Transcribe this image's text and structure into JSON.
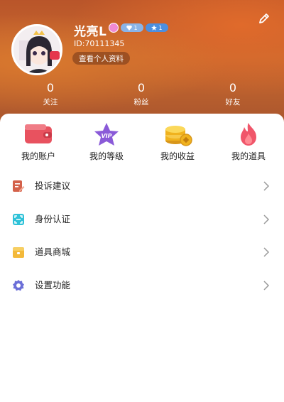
{
  "header": {
    "username": "光亮L",
    "badges": {
      "diamond_level": "1",
      "star_level": "1"
    },
    "user_id": "ID:70111345",
    "view_profile_label": "查看个人资料",
    "edit_icon": "edit-pencil-icon"
  },
  "stats": [
    {
      "value": "0",
      "label": "关注"
    },
    {
      "value": "0",
      "label": "粉丝"
    },
    {
      "value": "0",
      "label": "好友"
    }
  ],
  "shortcuts": [
    {
      "label": "我的账户",
      "icon": "wallet-icon"
    },
    {
      "label": "我的等级",
      "icon": "vip-star-icon"
    },
    {
      "label": "我的收益",
      "icon": "coins-icon"
    },
    {
      "label": "我的道具",
      "icon": "flame-icon"
    }
  ],
  "menu": [
    {
      "label": "投诉建议",
      "icon": "feedback-icon"
    },
    {
      "label": "身份认证",
      "icon": "id-scan-icon"
    },
    {
      "label": "道具商城",
      "icon": "shop-icon"
    },
    {
      "label": "设置功能",
      "icon": "settings-gear-icon"
    }
  ],
  "colors": {
    "header_orange": "#c96a2f",
    "wallet_red": "#e8525f",
    "vip_purple": "#8a5ad8",
    "coin_gold": "#f0b21e",
    "flame_red": "#f0566a",
    "chevron_gray": "#9a9a9a"
  }
}
